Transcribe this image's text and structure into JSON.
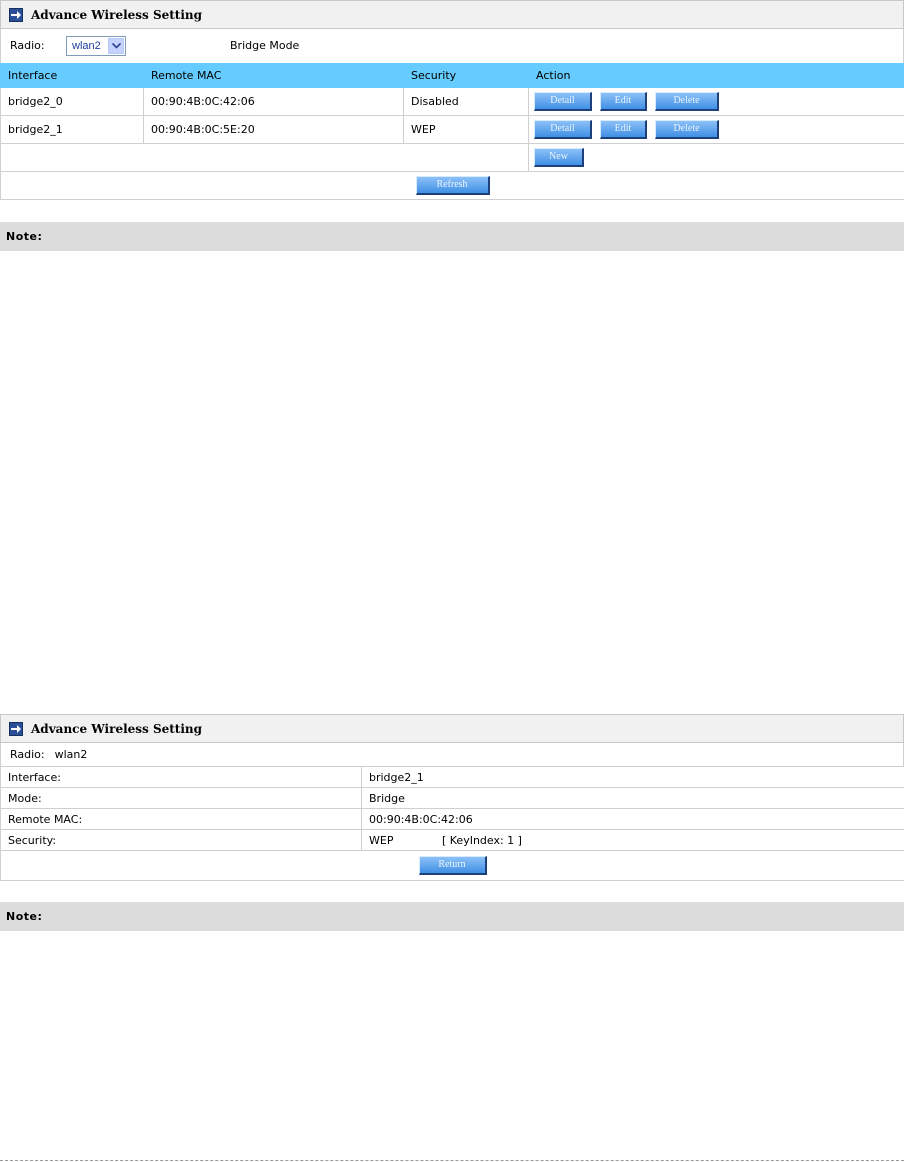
{
  "list_panel": {
    "title": "Advance Wireless Setting",
    "radio_label": "Radio:",
    "radio_selected": "wlan2",
    "mode_text": "Bridge Mode",
    "columns": [
      "Interface",
      "Remote MAC",
      "Security",
      "Action"
    ],
    "rows": [
      {
        "interface": "bridge2_0",
        "remote_mac": "00:90:4B:0C:42:06",
        "security": "Disabled"
      },
      {
        "interface": "bridge2_1",
        "remote_mac": "00:90:4B:0C:5E:20",
        "security": "WEP"
      }
    ],
    "buttons": {
      "detail": "Detail",
      "edit": "Edit",
      "delete": "Delete",
      "new": "New",
      "refresh": "Refresh"
    },
    "note_label": "Note:"
  },
  "detail_panel": {
    "title": "Advance Wireless Setting",
    "radio_label": "Radio:",
    "radio_value": "wlan2",
    "fields": [
      {
        "label": "Interface:",
        "value": "bridge2_1"
      },
      {
        "label": "Mode:",
        "value": "Bridge"
      },
      {
        "label": "Remote MAC:",
        "value": "00:90:4B:0C:42:06"
      },
      {
        "label": "Security:",
        "value": "WEP",
        "extra": "[ KeyIndex:  1 ]"
      }
    ],
    "return_label": "Return",
    "note_label": "Note:"
  },
  "icons": {
    "title_icon": "arrow-right-icon",
    "select_arrow": "chevron-down-icon"
  },
  "colors": {
    "header": "#66ccff",
    "title_icon": "#2a4f96",
    "button": "#3f8fe5",
    "note_bar": "#dcdcdc"
  }
}
